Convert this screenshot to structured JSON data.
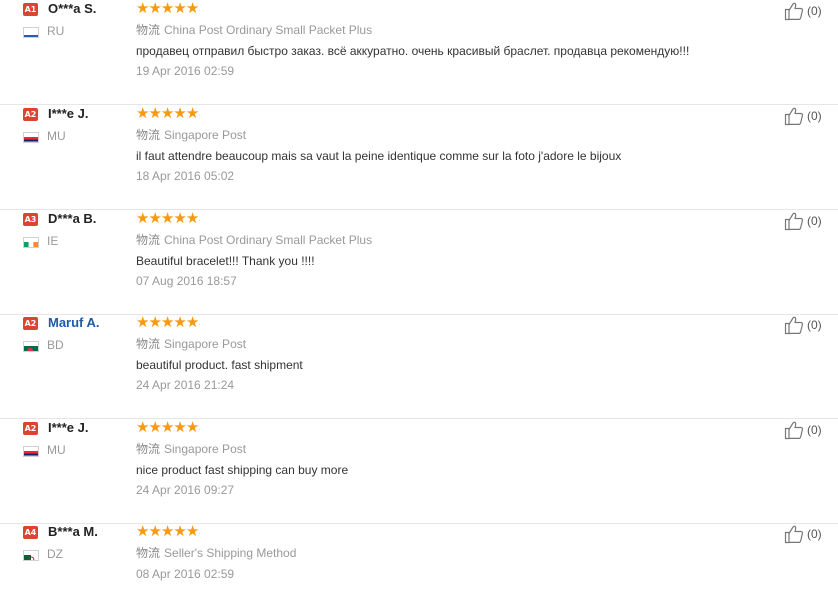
{
  "shipping_icon_label": "物流",
  "reviews": [
    {
      "level": "A1",
      "level_color": "#d9452e",
      "buyer": "O***a S.",
      "buyer_is_link": false,
      "country": "RU",
      "flag": "ru-flag-icon",
      "rating": 5,
      "shipping": "China Post Ordinary Small Packet Plus",
      "text": "продавец отправил быстро заказ. всё аккуратно. очень красивый браслет. продавца рекомендую!!!",
      "date": "19 Apr 2016 02:59",
      "helpful": "(0)"
    },
    {
      "level": "A2",
      "level_color": "#d9452e",
      "buyer": "I***e J.",
      "buyer_is_link": false,
      "country": "MU",
      "flag": "mu-flag-icon",
      "rating": 5,
      "shipping": "Singapore Post",
      "text": "il faut attendre beaucoup mais sa vaut la peine identique comme sur la foto j'adore le bijoux",
      "date": "18 Apr 2016 05:02",
      "helpful": "(0)"
    },
    {
      "level": "A3",
      "level_color": "#d9452e",
      "buyer": "D***a B.",
      "buyer_is_link": false,
      "country": "IE",
      "flag": "ie-flag-icon",
      "rating": 5,
      "shipping": "China Post Ordinary Small Packet Plus",
      "text": "Beautiful bracelet!!! Thank you !!!!",
      "date": "07 Aug 2016 18:57",
      "helpful": "(0)"
    },
    {
      "level": "A2",
      "level_color": "#d9452e",
      "buyer": "Maruf A.",
      "buyer_is_link": true,
      "country": "BD",
      "flag": "bd-flag-icon",
      "rating": 5,
      "shipping": "Singapore Post",
      "text": "beautiful product. fast shipment",
      "date": "24 Apr 2016 21:24",
      "helpful": "(0)"
    },
    {
      "level": "A2",
      "level_color": "#d9452e",
      "buyer": "I***e J.",
      "buyer_is_link": false,
      "country": "MU",
      "flag": "mu-flag-icon",
      "rating": 5,
      "shipping": "Singapore Post",
      "text": "nice product fast shipping can buy more",
      "date": "24 Apr 2016 09:27",
      "helpful": "(0)"
    },
    {
      "level": "A4",
      "level_color": "#d9452e",
      "buyer": "B***a M.",
      "buyer_is_link": false,
      "country": "DZ",
      "flag": "dz-flag-icon",
      "rating": 5,
      "shipping": "Seller's Shipping Method",
      "text": "",
      "date": "08 Apr 2016 02:59",
      "helpful": "(0)"
    }
  ]
}
